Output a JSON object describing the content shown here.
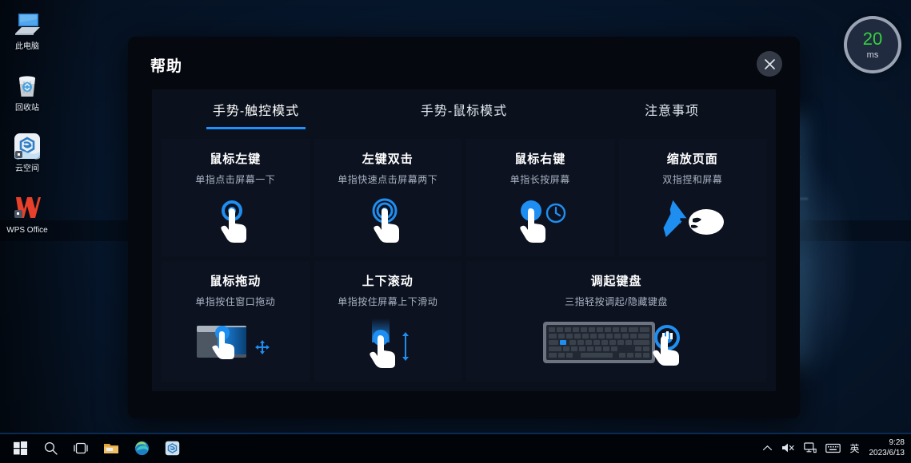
{
  "desktop": {
    "icons": [
      {
        "label": "此电脑",
        "icon": "this-pc-icon"
      },
      {
        "label": "回收站",
        "icon": "recycle-bin-icon"
      },
      {
        "label": "云空间",
        "icon": "cloud-space-icon"
      },
      {
        "label": "WPS Office",
        "icon": "wps-office-icon"
      }
    ]
  },
  "latency": {
    "value": "20",
    "unit": "ms",
    "color": "#34d13f"
  },
  "dialog": {
    "title": "帮助",
    "close_label": "×",
    "accent_color": "#1e90ff",
    "tabs": [
      {
        "label": "手势-触控模式",
        "active": true
      },
      {
        "label": "手势-鼠标模式",
        "active": false
      },
      {
        "label": "注意事项",
        "active": false
      }
    ],
    "cards": [
      {
        "title": "鼠标左键",
        "desc": "单指点击屏幕一下",
        "icon": "single-tap-icon",
        "wide": false
      },
      {
        "title": "左键双击",
        "desc": "单指快速点击屏幕两下",
        "icon": "double-tap-icon",
        "wide": false
      },
      {
        "title": "鼠标右键",
        "desc": "单指长按屏幕",
        "icon": "long-press-icon",
        "wide": false
      },
      {
        "title": "缩放页面",
        "desc": "双指捏和屏幕",
        "icon": "pinch-zoom-icon",
        "wide": false
      },
      {
        "title": "鼠标拖动",
        "desc": "单指按住窗口拖动",
        "icon": "drag-window-icon",
        "wide": false
      },
      {
        "title": "上下滚动",
        "desc": "单指按住屏幕上下滑动",
        "icon": "scroll-vertical-icon",
        "wide": false
      },
      {
        "title": "调起键盘",
        "desc": "三指轻按调起/隐藏键盘",
        "icon": "keyboard-toggle-icon",
        "wide": true
      }
    ]
  },
  "taskbar": {
    "buttons": [
      {
        "name": "start-icon"
      },
      {
        "name": "search-icon"
      },
      {
        "name": "task-view-icon"
      },
      {
        "name": "file-explorer-icon"
      },
      {
        "name": "edge-browser-icon"
      },
      {
        "name": "cloud-app-icon"
      }
    ],
    "tray": [
      {
        "name": "chevron-up-icon"
      },
      {
        "name": "speaker-muted-icon"
      },
      {
        "name": "network-monitor-icon"
      },
      {
        "name": "touch-keyboard-icon"
      }
    ],
    "ime": "英",
    "time": "9:28",
    "date": "2023/6/13"
  }
}
